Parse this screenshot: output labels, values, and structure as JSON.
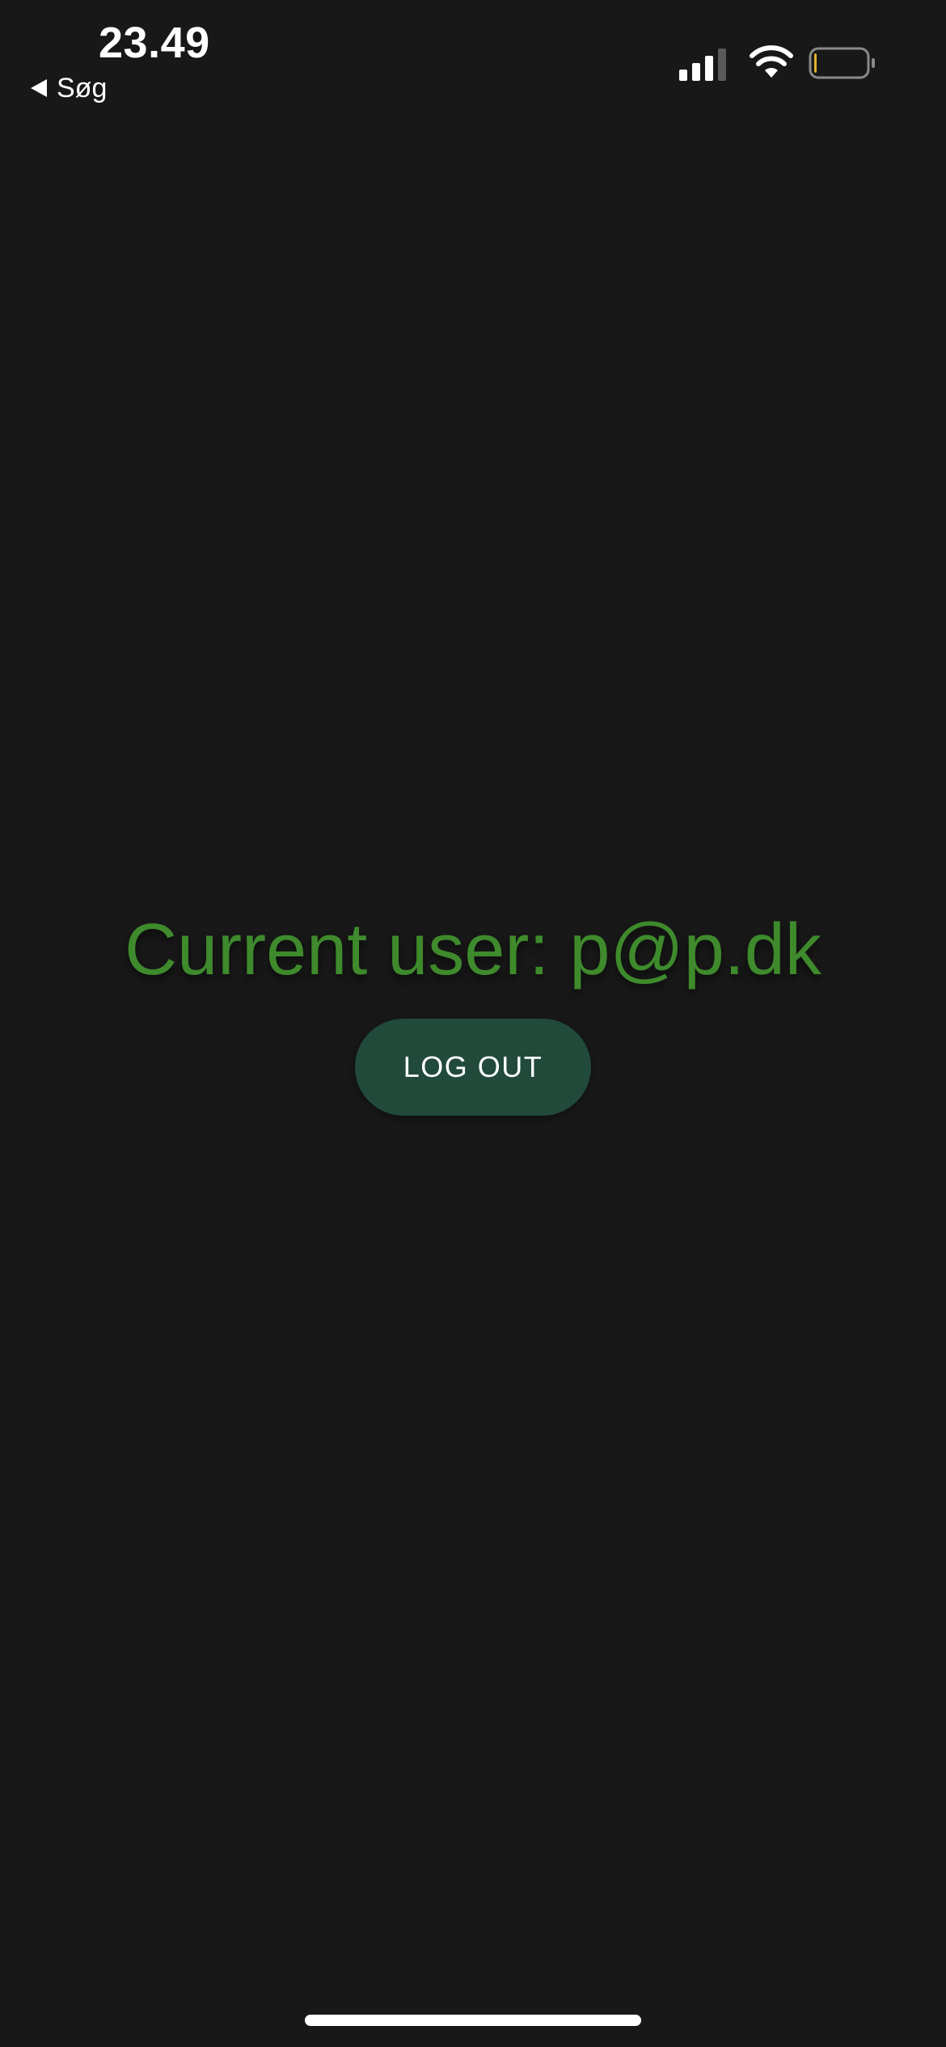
{
  "status_bar": {
    "time": "23.49",
    "back_label": "Søg",
    "icons": {
      "back": "back-arrow-icon",
      "signal": "cellular-signal-icon",
      "wifi": "wifi-icon",
      "battery": "battery-low-icon"
    },
    "battery_level": 0.05,
    "battery_color": "#e0b030"
  },
  "main": {
    "current_user_text": "Current user: p@p.dk",
    "logout_label": "LOG OUT"
  },
  "colors": {
    "background": "#181818",
    "accent_text": "#3e8a2c",
    "button_bg": "#214a3b"
  }
}
